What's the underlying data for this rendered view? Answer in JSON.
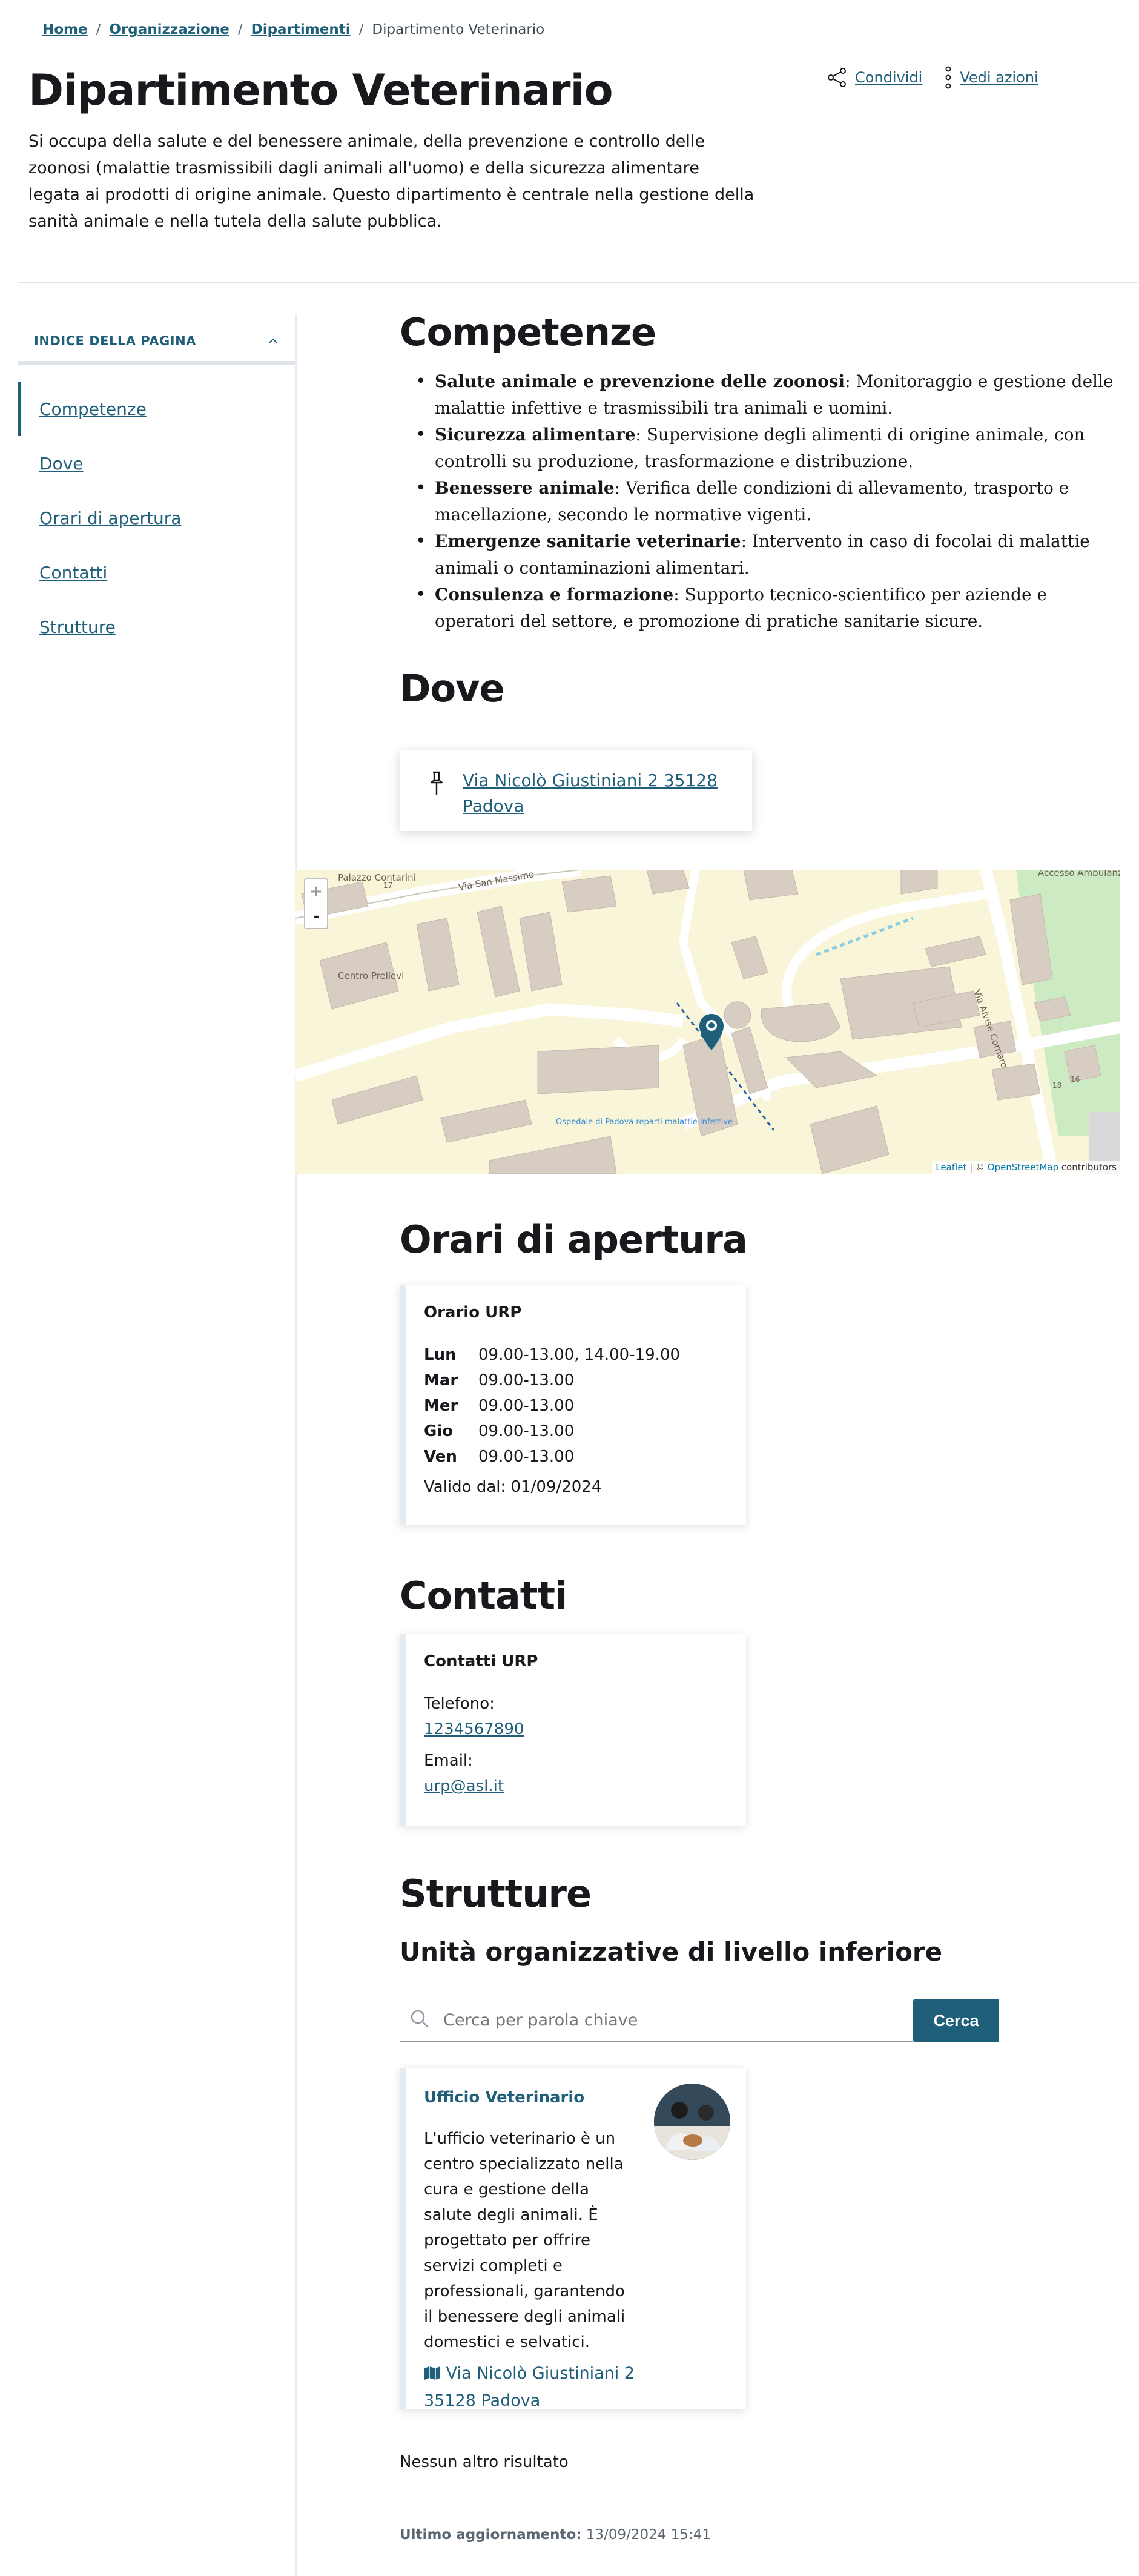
{
  "breadcrumb": {
    "items": [
      "Home",
      "Organizzazione",
      "Dipartimenti"
    ],
    "current": "Dipartimento Veterinario",
    "separator": "/"
  },
  "page": {
    "title": "Dipartimento Veterinario",
    "intro": "Si occupa della salute e del benessere animale, della prevenzione e controllo delle zoonosi (malattie trasmissibili dagli animali all'uomo) e della sicurezza alimentare legata ai prodotti di origine animale. Questo dipartimento è centrale nella gestione della sanità animale e nella tutela della salute pubblica."
  },
  "actions": {
    "share_label": "Condividi",
    "more_label": "Vedi azioni"
  },
  "toc": {
    "title": "INDICE DELLA PAGINA",
    "items": [
      "Competenze",
      "Dove",
      "Orari di apertura",
      "Contatti",
      "Strutture"
    ],
    "active": "Competenze"
  },
  "competenze": {
    "heading": "Competenze",
    "items": [
      {
        "term": "Salute animale e prevenzione delle zoonosi",
        "text": ": Monitoraggio e gestione delle malattie infettive e trasmissibili tra animali e uomini."
      },
      {
        "term": "Sicurezza alimentare",
        "text": ": Supervisione degli alimenti di origine animale, con controlli su produzione, trasformazione e distribuzione."
      },
      {
        "term": "Benessere animale",
        "text": ": Verifica delle condizioni di allevamento, trasporto e macellazione, secondo le normative vigenti."
      },
      {
        "term": "Emergenze sanitarie veterinarie",
        "text": ": Intervento in caso di focolai di malattie animali o contaminazioni alimentari."
      },
      {
        "term": "Consulenza e formazione",
        "text": ": Supporto tecnico-scientifico per aziende e operatori del settore, e promozione di pratiche sanitarie sicure."
      }
    ]
  },
  "dove": {
    "heading": "Dove",
    "address_line1": "Via Nicolò Giustiniani 2 35128",
    "address_line2": "Padova"
  },
  "map": {
    "zoom_in": "+",
    "zoom_out": "-",
    "labels": {
      "palazzo": "Palazzo Contarini",
      "centro_prelievi": "Centro Prelievi",
      "via_san": "Via San Massimo",
      "via_alvise": "Via Alvise Cornaro",
      "ospedale": "Ospedale di Padova reparti malattie infettive",
      "accesso": "Accesso Ambulanze",
      "num_17": "17",
      "num_16": "16",
      "num_18": "18"
    },
    "attribution_leaflet": "Leaflet",
    "attribution_sep": " | © ",
    "attribution_osm": "OpenStreetMap",
    "attribution_tail": " contributors"
  },
  "orari": {
    "heading": "Orari di apertura",
    "card_title": "Orario URP",
    "rows": [
      {
        "day": "Lun",
        "hours": "09.00-13.00, 14.00-19.00"
      },
      {
        "day": "Mar",
        "hours": "09.00-13.00"
      },
      {
        "day": "Mer",
        "hours": "09.00-13.00"
      },
      {
        "day": "Gio",
        "hours": "09.00-13.00"
      },
      {
        "day": "Ven",
        "hours": "09.00-13.00"
      }
    ],
    "valid_from": "Valido dal: 01/09/2024"
  },
  "contatti": {
    "heading": "Contatti",
    "card_title": "Contatti URP",
    "phone_label": "Telefono:",
    "phone": "1234567890",
    "email_label": "Email:",
    "email": "urp@asl.it"
  },
  "strutture": {
    "heading": "Strutture",
    "subheading": "Unità organizzative di livello inferiore",
    "search_placeholder": "Cerca per parola chiave",
    "search_button": "Cerca",
    "card": {
      "title": "Ufficio Veterinario",
      "description": "L'ufficio veterinario è un centro specializzato nella cura e gestione della salute degli animali. È progettato per offrire servizi completi e professionali, garantendo il benessere degli animali domestici e selvatici.",
      "address": "Via Nicolò Giustiniani 2 35128 Padova"
    },
    "no_more": "Nessun altro risultato"
  },
  "footer": {
    "updated_label": "Ultimo aggiornamento:",
    "updated_value": "13/09/2024 15:41"
  },
  "colors": {
    "primary": "#1f5f7a",
    "text": "#17191c",
    "map_pin": "#1f5f7a"
  }
}
